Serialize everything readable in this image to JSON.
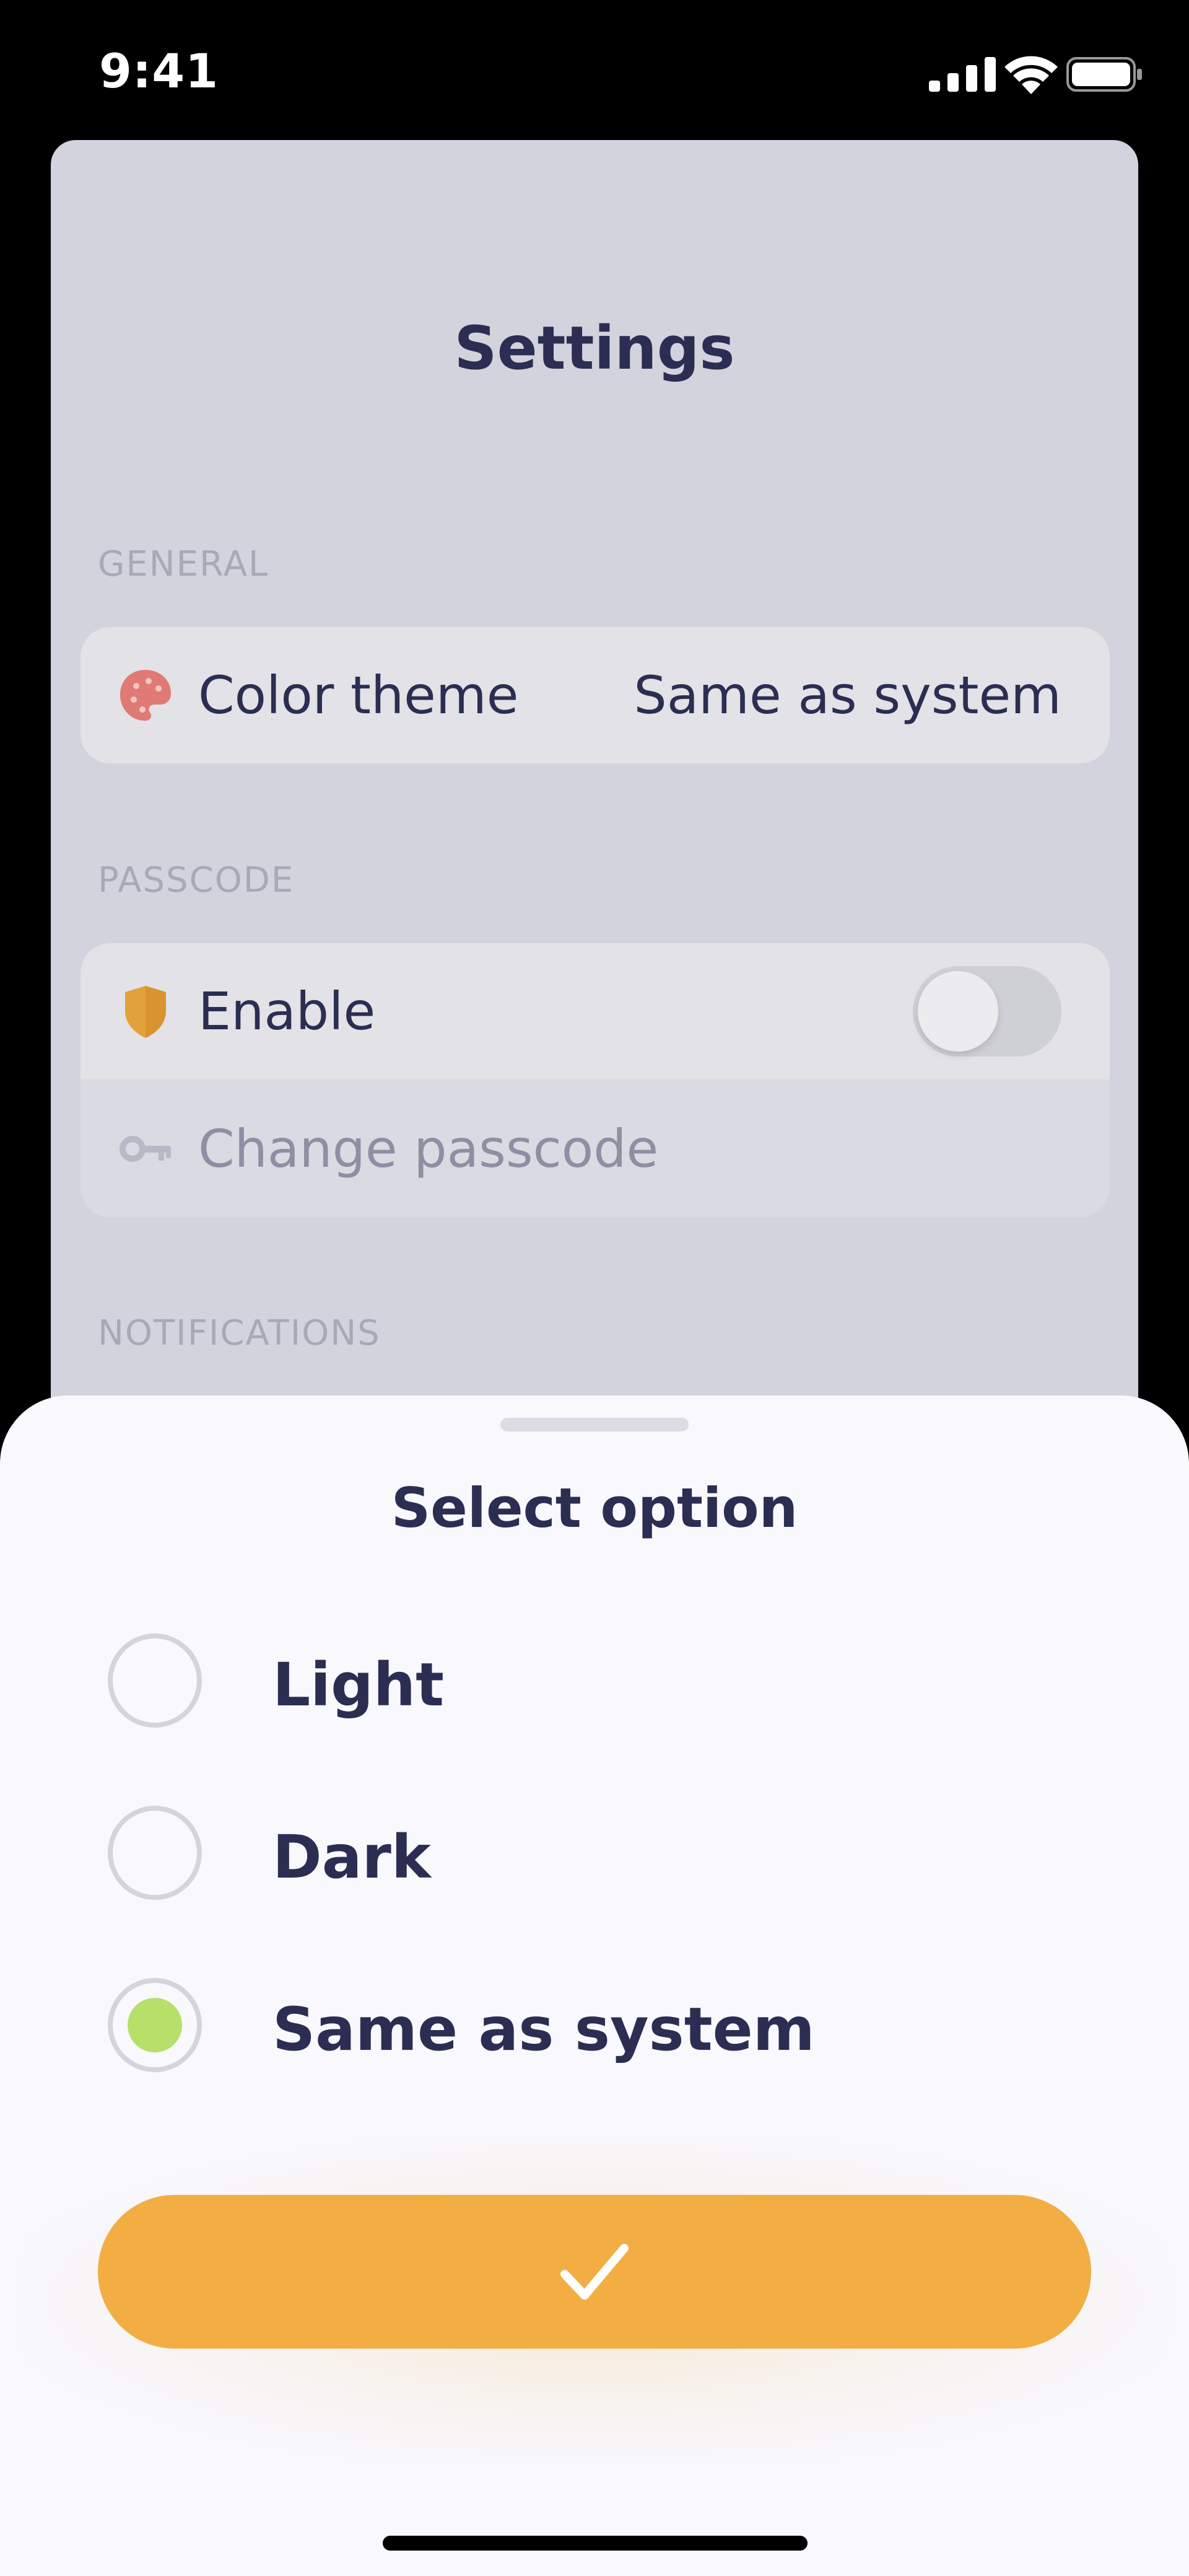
{
  "status_bar": {
    "time": "9:41",
    "icons": [
      "signal-icon",
      "wifi-icon",
      "battery-icon"
    ]
  },
  "settings": {
    "title": "Settings",
    "sections": {
      "general": {
        "label": "GENERAL",
        "color_theme": {
          "label": "Color theme",
          "value": "Same as system",
          "icon": "palette-icon"
        }
      },
      "passcode": {
        "label": "PASSCODE",
        "enable": {
          "label": "Enable",
          "icon": "shield-icon",
          "toggle_on": false
        },
        "change": {
          "label": "Change passcode",
          "icon": "key-icon",
          "disabled": true
        }
      },
      "notifications": {
        "label": "NOTIFICATIONS"
      }
    }
  },
  "sheet": {
    "title": "Select option",
    "options": [
      {
        "label": "Light",
        "selected": false
      },
      {
        "label": "Dark",
        "selected": false
      },
      {
        "label": "Same as system",
        "selected": true
      }
    ],
    "confirm_icon": "checkmark-icon"
  },
  "colors": {
    "accent": "#f2ae43",
    "selected_radio": "#b6e06a",
    "text_primary": "#2b2e52",
    "palette_icon": "#e07a74",
    "shield_icon": "#e3a13c"
  }
}
